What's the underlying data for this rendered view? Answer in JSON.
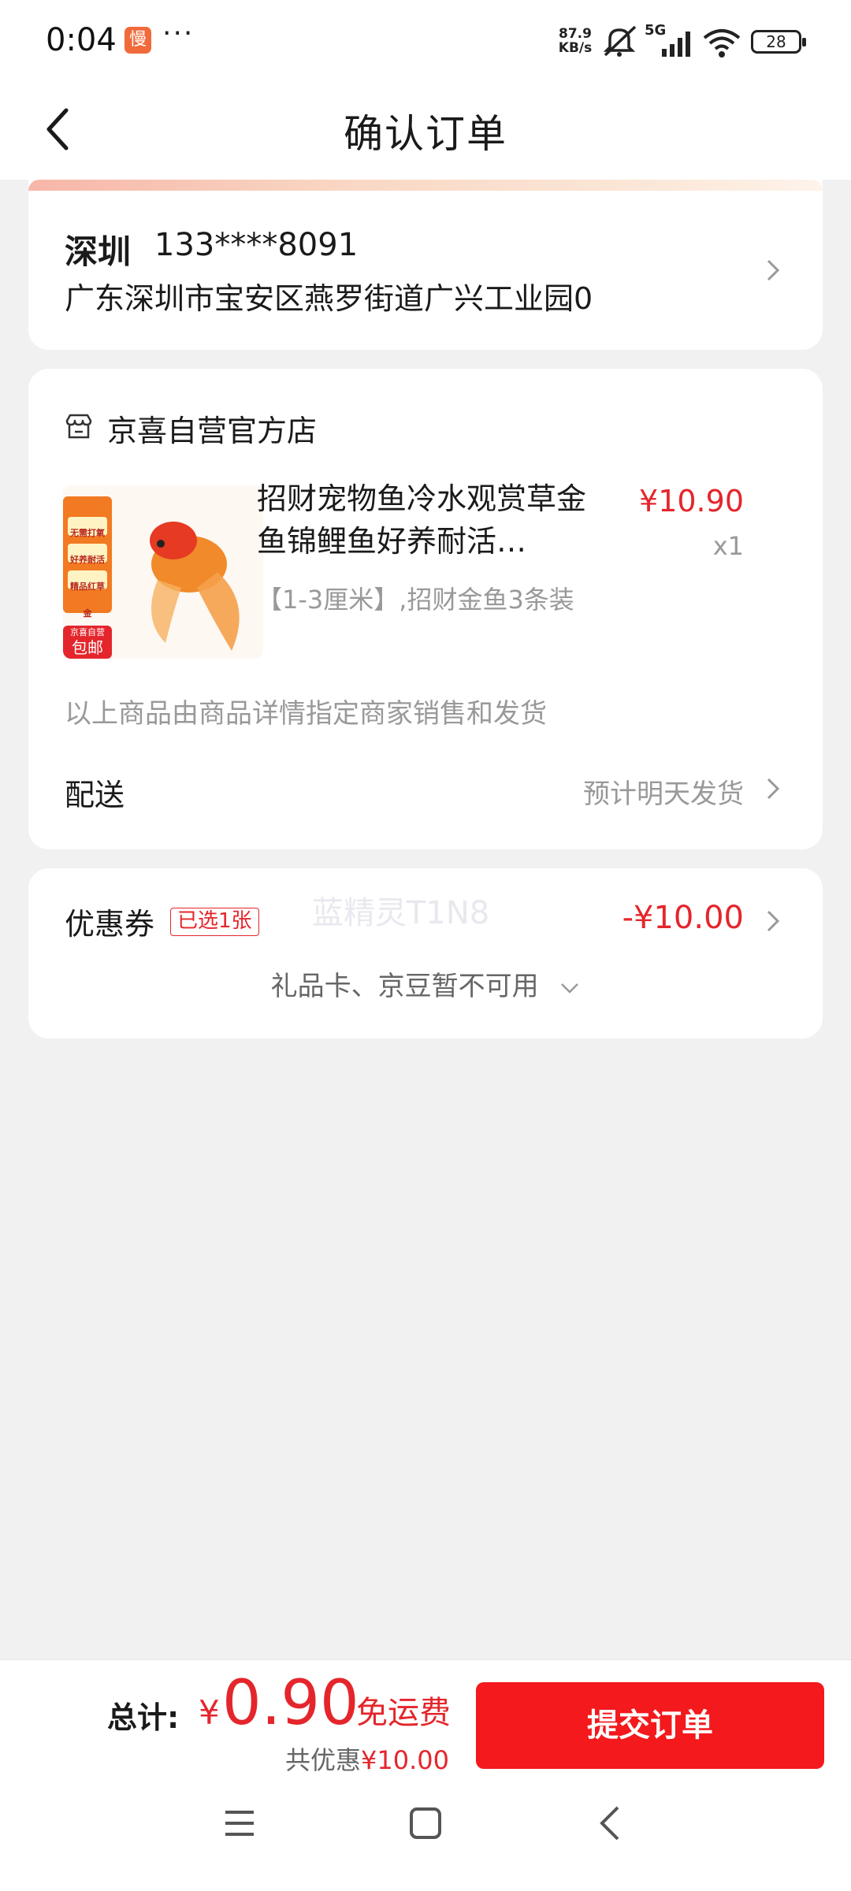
{
  "status_bar": {
    "time": "0:04",
    "app_badge": "慢",
    "more": "···",
    "net_speed_value": "87.9",
    "net_speed_unit": "KB/s",
    "network": "5G",
    "battery": "28"
  },
  "header": {
    "title": "确认订单"
  },
  "address": {
    "city": "深圳",
    "phone": "133****8091",
    "detail": "广东深圳市宝安区燕罗街道广兴工业园0"
  },
  "store": {
    "name": "京喜自营官方店",
    "product": {
      "title": "招财宠物鱼冷水观赏草金鱼锦鲤鱼好养耐活…",
      "price": "¥10.90",
      "quantity": "x1",
      "spec": "【1-3厘米】,招财金鱼3条装",
      "image_tags": [
        "无需打氧",
        "好养耐活",
        "精品红草金"
      ],
      "image_badge_top": "京喜自营",
      "image_badge_bottom": "包邮"
    },
    "seller_note": "以上商品由商品详情指定商家销售和发货",
    "shipping_label": "配送",
    "shipping_value": "预计明天发货"
  },
  "coupon": {
    "label": "优惠券",
    "badge": "已选1张",
    "watermark": "蓝精灵T1N8",
    "amount": "-¥10.00",
    "gift_row": "礼品卡、京豆暂不可用"
  },
  "footer": {
    "total_label": "总计:",
    "currency": "¥",
    "total_amount": "0.90",
    "free_shipping": "免运费",
    "saved_prefix": "共优惠",
    "saved_amount": "¥10.00",
    "submit_label": "提交订单"
  },
  "colors": {
    "accent_red": "#e4262c",
    "button_red": "#f3191c"
  }
}
